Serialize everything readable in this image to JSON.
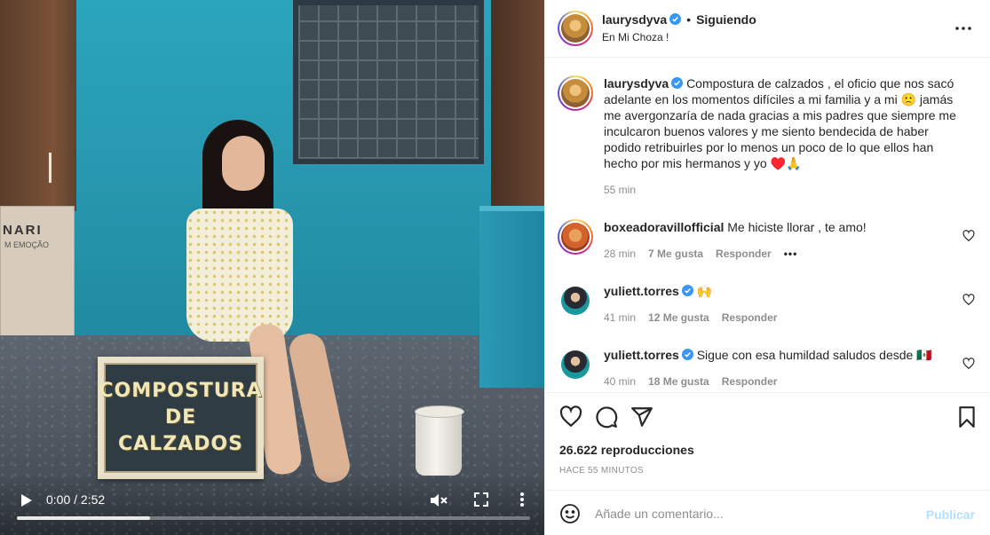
{
  "video": {
    "time": "0:00 / 2:52",
    "progress_fraction": 0.26,
    "scene": {
      "box_brand": "NARI",
      "box_subtext": "M EMOÇÃO",
      "sign_line1": "COMPOSTURA",
      "sign_line2": "DE",
      "sign_line3": "CALZADOS"
    },
    "icons": {
      "play": "play-icon",
      "mute": "muted-speaker-icon",
      "fullscreen": "fullscreen-icon",
      "more": "vertical-dots-icon"
    }
  },
  "header": {
    "username": "laurysdyva",
    "dot": "•",
    "follow_label": "Siguiendo",
    "location": "En Mi Choza !",
    "more_icon": "horizontal-dots-icon"
  },
  "caption": {
    "username": "laurysdyva",
    "text": "Compostura de calzados , el oficio que nos sacó adelante en los momentos difíciles a mi familia y a mi 🙁 jamás me avergonzaría de nada gracias a mis padres que siempre me inculcaron buenos valores y me siento bendecida de haber podido retribuirles por lo menos un poco de lo que ellos han hecho por mis hermanos y yo ♥️🙏",
    "time": "55 min"
  },
  "comments": [
    {
      "username": "boxeadoravillofficial",
      "text": "Me hiciste llorar , te amo!",
      "time": "28 min",
      "likes": "7 Me gusta",
      "reply": "Responder",
      "more": "•••"
    },
    {
      "username": "yuliett.torres",
      "text": "🙌",
      "time": "41 min",
      "likes": "12 Me gusta",
      "reply": "Responder"
    },
    {
      "username": "yuliett.torres",
      "text": "Sigue con esa humildad saludos desde 🇲🇽",
      "time": "40 min",
      "likes": "18 Me gusta",
      "reply": "Responder"
    }
  ],
  "actions": {
    "views": "26.622 reproducciones",
    "time_ago": "HACE 55 MINUTOS",
    "icons": [
      "heart-icon",
      "comment-icon",
      "share-icon",
      "bookmark-icon"
    ]
  },
  "comment_box": {
    "placeholder": "Añade un comentario...",
    "post_label": "Publicar"
  },
  "colors": {
    "verified": "#3897f0",
    "link_disabled": "#b2dffc",
    "secondary_text": "#8e8e8e"
  }
}
